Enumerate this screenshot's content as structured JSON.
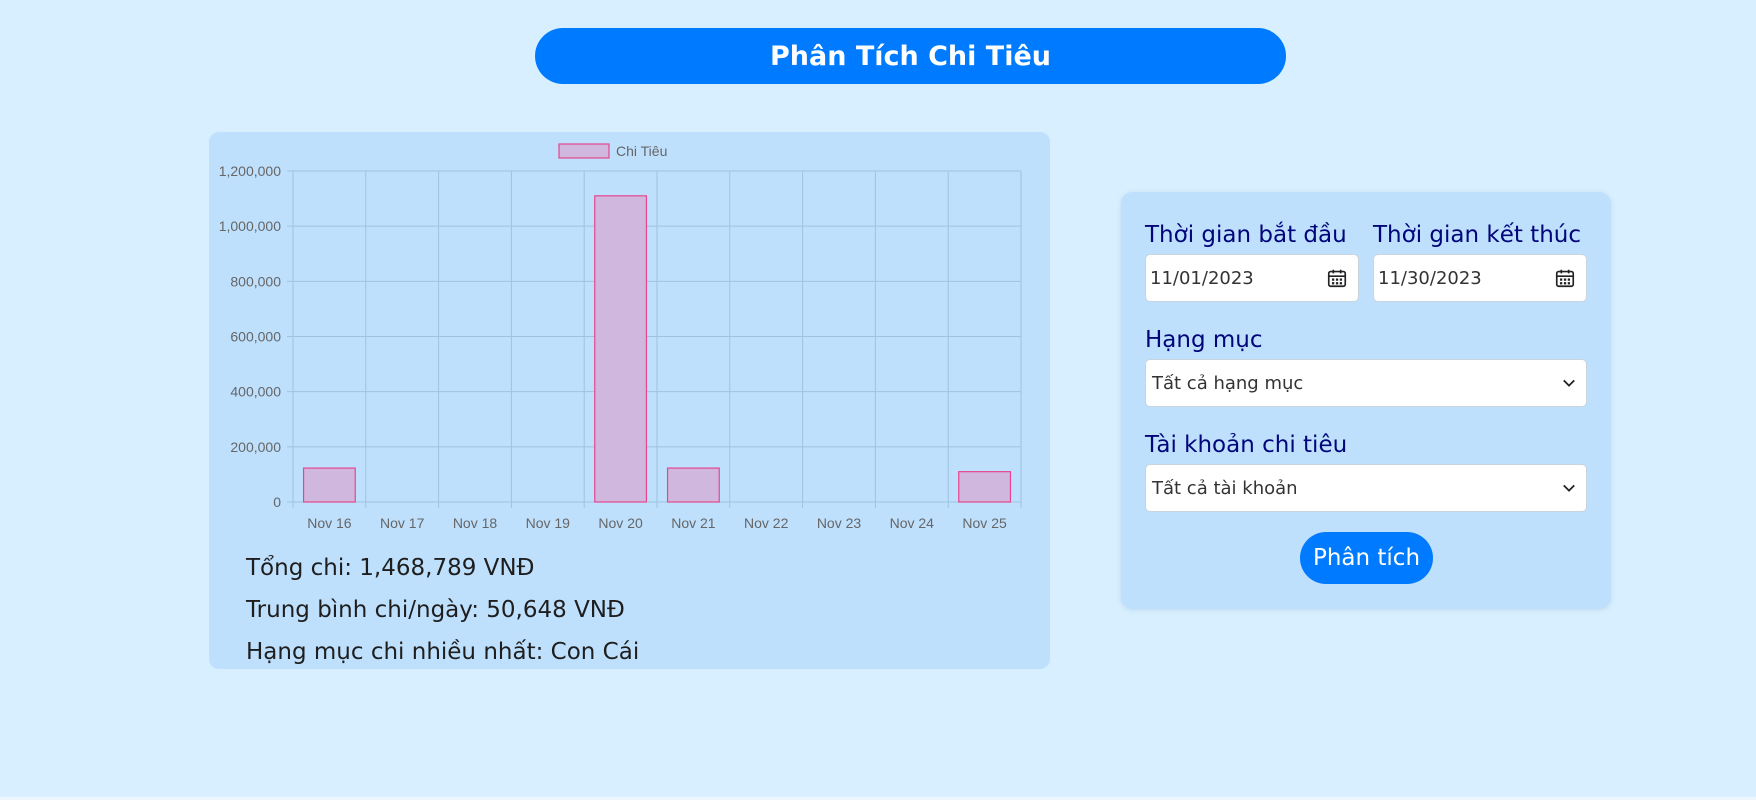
{
  "header": {
    "title": "Phân Tích Chi Tiêu"
  },
  "chart_data": {
    "type": "bar",
    "categories": [
      "Nov 16",
      "Nov 17",
      "Nov 18",
      "Nov 19",
      "Nov 20",
      "Nov 21",
      "Nov 22",
      "Nov 23",
      "Nov 24",
      "Nov 25"
    ],
    "series": [
      {
        "name": "Chi Tiêu",
        "values": [
          123000,
          0,
          0,
          0,
          1110000,
          123000,
          0,
          0,
          0,
          110000
        ]
      }
    ],
    "title": "",
    "xlabel": "",
    "ylabel": "",
    "ylim": [
      0,
      1200000
    ],
    "yticks": [
      "1,200,000",
      "1,000,000",
      "800,000",
      "600,000",
      "400,000",
      "200,000",
      "0"
    ],
    "grid": true,
    "legend": "top-center",
    "colors": {
      "fill": "#d0b7de",
      "stroke": "#e8458f",
      "grid": "#9fc3df",
      "tick_text": "#666666"
    }
  },
  "stats": {
    "total_label": "Tổng chi:",
    "total_value": "1,468,789 VNĐ",
    "avg_label": "Trung bình chi/ngày:",
    "avg_value": "50,648 VNĐ",
    "top_category_label": "Hạng mục chi nhiều nhất:",
    "top_category_value": "Con Cái"
  },
  "filters": {
    "start_label": "Thời gian bắt đầu",
    "start_value": "11/01/2023",
    "end_label": "Thời gian kết thúc",
    "end_value": "11/30/2023",
    "category_label": "Hạng mục",
    "category_value": "Tất cả hạng mục",
    "account_label": "Tài khoản chi tiêu",
    "account_value": "Tất cả tài khoản",
    "analyze_button": "Phân tích"
  },
  "icons": {
    "calendar": "calendar-icon",
    "dropdown": "chevron-down-icon"
  },
  "colors": {
    "accent": "#007bff",
    "page_bg": "#d7effe",
    "card_bg": "#bee0fd",
    "label_text": "#00057a"
  }
}
